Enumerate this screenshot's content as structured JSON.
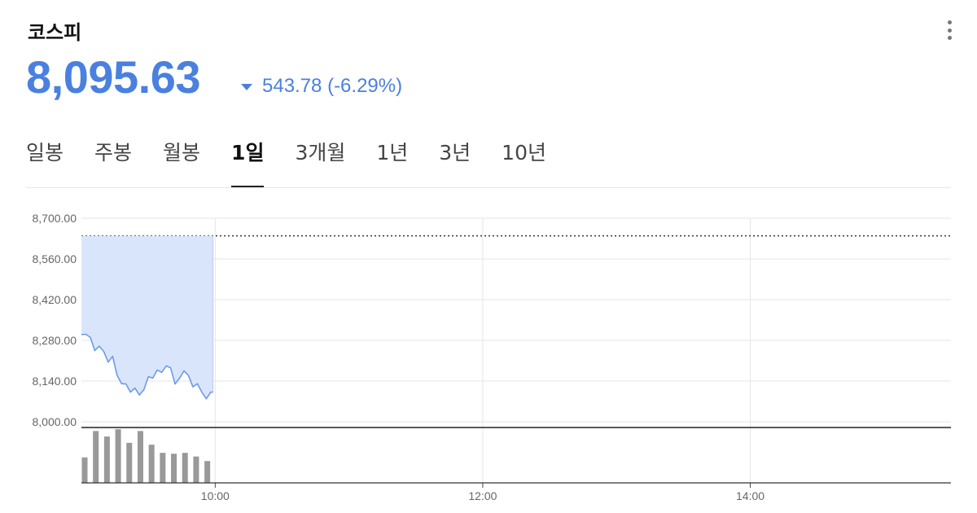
{
  "header": {
    "title": "코스피",
    "price": "8,095.63",
    "change": "543.78 (-6.29%)",
    "change_color": "#4a80e0"
  },
  "tabs": [
    {
      "label": "일봉",
      "active": false
    },
    {
      "label": "주봉",
      "active": false
    },
    {
      "label": "월봉",
      "active": false
    },
    {
      "label": "1일",
      "active": true
    },
    {
      "label": "3개월",
      "active": false
    },
    {
      "label": "1년",
      "active": false
    },
    {
      "label": "3년",
      "active": false
    },
    {
      "label": "10년",
      "active": false
    }
  ],
  "chart_data": {
    "type": "line",
    "ylim": [
      8000,
      8700
    ],
    "yticks": [
      "8,700.00",
      "8,560.00",
      "8,420.00",
      "8,280.00",
      "8,140.00",
      "8,000.00"
    ],
    "xlim": [
      "09:00",
      "15:30"
    ],
    "xticks": [
      "10:00",
      "12:00",
      "14:00"
    ],
    "previous_close": 8639.41,
    "line_color": "#6e9ae6",
    "fill_color": "#d9e5fa",
    "x": [
      "09:00",
      "09:02",
      "09:04",
      "09:06",
      "09:08",
      "09:10",
      "09:12",
      "09:14",
      "09:16",
      "09:18",
      "09:20",
      "09:22",
      "09:24",
      "09:26",
      "09:28",
      "09:30",
      "09:32",
      "09:34",
      "09:36",
      "09:38",
      "09:40",
      "09:42",
      "09:44",
      "09:46",
      "09:48",
      "09:50",
      "09:52",
      "09:54",
      "09:56",
      "09:58",
      "09:59"
    ],
    "values": [
      8300,
      8301,
      8290,
      8245,
      8260,
      8242,
      8205,
      8225,
      8160,
      8131,
      8130,
      8102,
      8116,
      8092,
      8110,
      8155,
      8150,
      8178,
      8170,
      8192,
      8186,
      8130,
      8150,
      8175,
      8160,
      8120,
      8131,
      8102,
      8079,
      8102,
      8102
    ],
    "volume": {
      "x": [
        "09:00",
        "09:05",
        "09:10",
        "09:15",
        "09:20",
        "09:25",
        "09:30",
        "09:35",
        "09:40",
        "09:45",
        "09:50",
        "09:55"
      ],
      "values": [
        28,
        57,
        51,
        59,
        44,
        57,
        42,
        33,
        32,
        33,
        29,
        24
      ],
      "color": "#999999"
    }
  }
}
